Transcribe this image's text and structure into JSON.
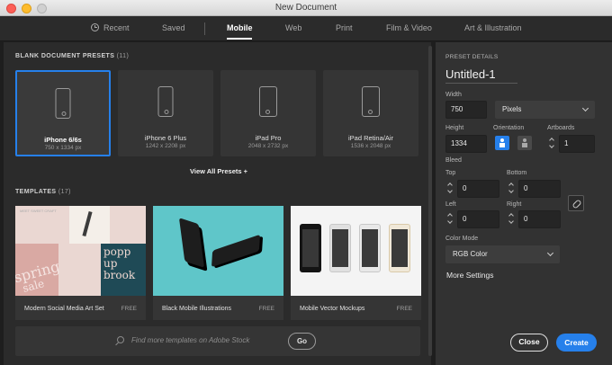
{
  "window": {
    "title": "New Document"
  },
  "tabs": [
    {
      "label": "Recent"
    },
    {
      "label": "Saved"
    },
    {
      "label": "Mobile"
    },
    {
      "label": "Web"
    },
    {
      "label": "Print"
    },
    {
      "label": "Film & Video"
    },
    {
      "label": "Art & Illustration"
    }
  ],
  "presets_section": {
    "title": "BLANK DOCUMENT PRESETS",
    "count": "(11)"
  },
  "presets": [
    {
      "name": "iPhone 6/6s",
      "size": "750 x 1334 px"
    },
    {
      "name": "iPhone 6 Plus",
      "size": "1242 x 2208 px"
    },
    {
      "name": "iPad Pro",
      "size": "2048 x 2732 px"
    },
    {
      "name": "iPad Retina/Air",
      "size": "1536 x 2048 px"
    }
  ],
  "view_all": "View All Presets +",
  "templates_section": {
    "title": "TEMPLATES",
    "count": "(17)"
  },
  "templates": [
    {
      "name": "Modern Social Media Art Set",
      "badge": "FREE"
    },
    {
      "name": "Black Mobile Illustrations",
      "badge": "FREE"
    },
    {
      "name": "Mobile Vector Mockups",
      "badge": "FREE"
    }
  ],
  "tpl1_text": {
    "top": "MEET SWEET CRAFT",
    "spring1": "spring",
    "spring2": "sale",
    "popup1": "popp",
    "popup2": "up",
    "popup3": "brook"
  },
  "search": {
    "placeholder": "Find more templates on Adobe Stock",
    "go": "Go"
  },
  "details": {
    "header": "PRESET DETAILS",
    "doc_name": "Untitled-1",
    "width_label": "Width",
    "width": "750",
    "unit": "Pixels",
    "height_label": "Height",
    "height": "1334",
    "orientation_label": "Orientation",
    "artboards_label": "Artboards",
    "artboards": "1",
    "bleed_label": "Bleed",
    "top_label": "Top",
    "top": "0",
    "bottom_label": "Bottom",
    "bottom": "0",
    "left_label": "Left",
    "left": "0",
    "right_label": "Right",
    "right": "0",
    "color_mode_label": "Color Mode",
    "color_mode": "RGB Color",
    "more_settings": "More Settings"
  },
  "buttons": {
    "close": "Close",
    "create": "Create"
  },
  "colors": {
    "accent": "#2680eb",
    "teal": "#5fc6c9",
    "pink": "#e8c5c3"
  }
}
